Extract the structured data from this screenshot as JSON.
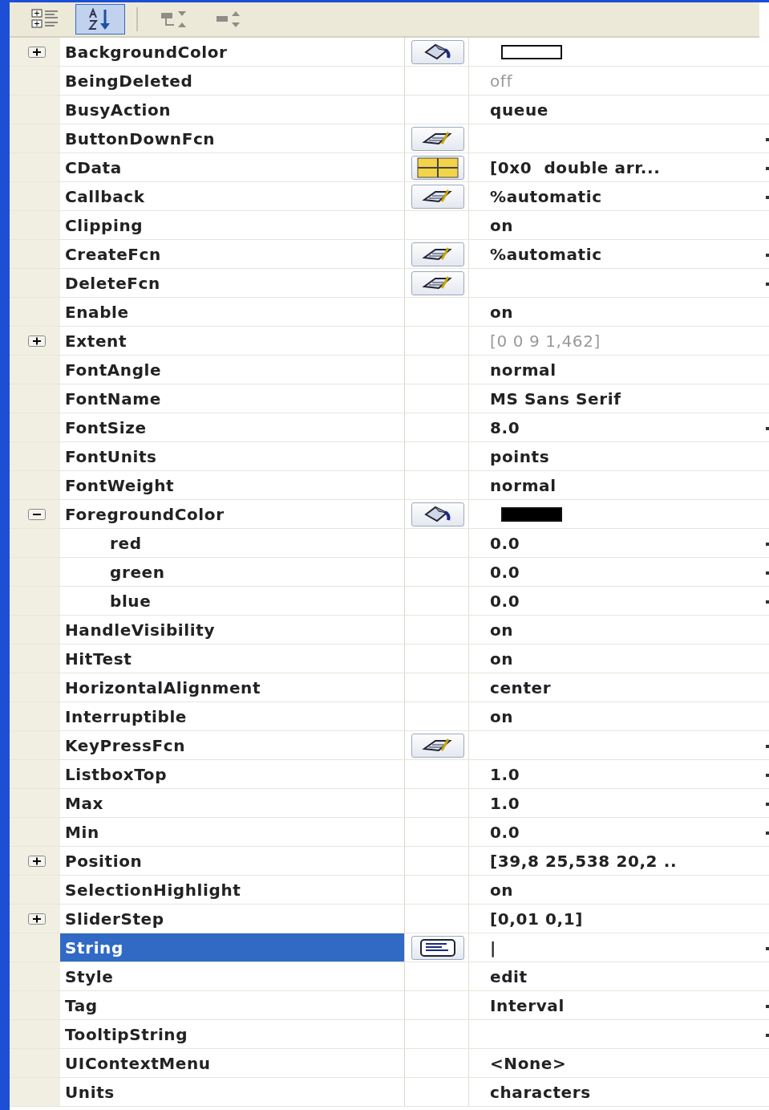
{
  "toolbar": [
    {
      "kind": "categorized",
      "selected": false,
      "disabled": false
    },
    {
      "kind": "alphabetical",
      "selected": true,
      "disabled": false
    },
    {
      "kind": "expand",
      "selected": false,
      "disabled": true
    },
    {
      "kind": "collapse",
      "selected": false,
      "disabled": true
    }
  ],
  "properties": [
    {
      "name": "BackgroundColor",
      "selected": false,
      "expanded": false,
      "kind": "color",
      "color": "#ffffff"
    },
    {
      "name": "BeingDeleted",
      "selected": false,
      "kind": "plain",
      "value": "off",
      "disabled": true
    },
    {
      "name": "BusyAction",
      "selected": false,
      "kind": "plain",
      "value": "queue"
    },
    {
      "name": "ButtonDownFcn",
      "selected": false,
      "kind": "callback",
      "more": true
    },
    {
      "name": "CData",
      "selected": false,
      "kind": "matrix",
      "value": "[0x0  double arr...",
      "more": true
    },
    {
      "name": "Callback",
      "selected": false,
      "kind": "callback",
      "value": "%automatic",
      "more": true
    },
    {
      "name": "Clipping",
      "selected": false,
      "kind": "plain",
      "value": "on"
    },
    {
      "name": "CreateFcn",
      "selected": false,
      "kind": "callback",
      "value": "%automatic",
      "more": true
    },
    {
      "name": "DeleteFcn",
      "selected": false,
      "kind": "callback",
      "more": true
    },
    {
      "name": "Enable",
      "selected": false,
      "kind": "plain",
      "value": "on"
    },
    {
      "name": "Extent",
      "selected": false,
      "expanded": false,
      "kind": "plain",
      "value": "[0 0 9 1,462]",
      "disabled": true
    },
    {
      "name": "FontAngle",
      "selected": false,
      "kind": "plain",
      "value": "normal"
    },
    {
      "name": "FontName",
      "selected": false,
      "kind": "plain",
      "value": "MS Sans Serif"
    },
    {
      "name": "FontSize",
      "selected": false,
      "kind": "plain",
      "value": "8.0",
      "more": true
    },
    {
      "name": "FontUnits",
      "selected": false,
      "kind": "plain",
      "value": "points"
    },
    {
      "name": "FontWeight",
      "selected": false,
      "kind": "plain",
      "value": "normal"
    },
    {
      "name": "ForegroundColor",
      "selected": false,
      "expanded": true,
      "kind": "color",
      "color": "#000000",
      "children": [
        {
          "name": "red",
          "selected": false,
          "value": "0.0",
          "more": true
        },
        {
          "name": "green",
          "selected": false,
          "value": "0.0",
          "more": true
        },
        {
          "name": "blue",
          "selected": false,
          "value": "0.0",
          "more": true
        }
      ]
    },
    {
      "name": "HandleVisibility",
      "selected": false,
      "kind": "plain",
      "value": "on"
    },
    {
      "name": "HitTest",
      "selected": false,
      "kind": "plain",
      "value": "on"
    },
    {
      "name": "HorizontalAlignment",
      "selected": false,
      "kind": "plain",
      "value": "center"
    },
    {
      "name": "Interruptible",
      "selected": false,
      "kind": "plain",
      "value": "on"
    },
    {
      "name": "KeyPressFcn",
      "selected": false,
      "kind": "callback",
      "more": true
    },
    {
      "name": "ListboxTop",
      "selected": false,
      "kind": "plain",
      "value": "1.0",
      "more": true
    },
    {
      "name": "Max",
      "selected": false,
      "kind": "plain",
      "value": "1.0",
      "more": true
    },
    {
      "name": "Min",
      "selected": false,
      "kind": "plain",
      "value": "0.0",
      "more": true
    },
    {
      "name": "Position",
      "selected": false,
      "expanded": false,
      "kind": "plain",
      "value": "[39,8 25,538 20,2 .."
    },
    {
      "name": "SelectionHighlight",
      "selected": false,
      "kind": "plain",
      "value": "on"
    },
    {
      "name": "SliderStep",
      "selected": false,
      "expanded": false,
      "kind": "plain",
      "value": "[0,01 0,1]"
    },
    {
      "name": "String",
      "selected": true,
      "kind": "text",
      "value": "|",
      "more": true
    },
    {
      "name": "Style",
      "selected": false,
      "kind": "plain",
      "value": "edit"
    },
    {
      "name": "Tag",
      "selected": false,
      "kind": "plain",
      "value": "Interval",
      "more": true
    },
    {
      "name": "TooltipString",
      "selected": false,
      "kind": "plain",
      "more": true
    },
    {
      "name": "UIContextMenu",
      "selected": false,
      "kind": "plain",
      "value": "<None>"
    },
    {
      "name": "Units",
      "selected": false,
      "kind": "plain",
      "value": "characters"
    }
  ]
}
